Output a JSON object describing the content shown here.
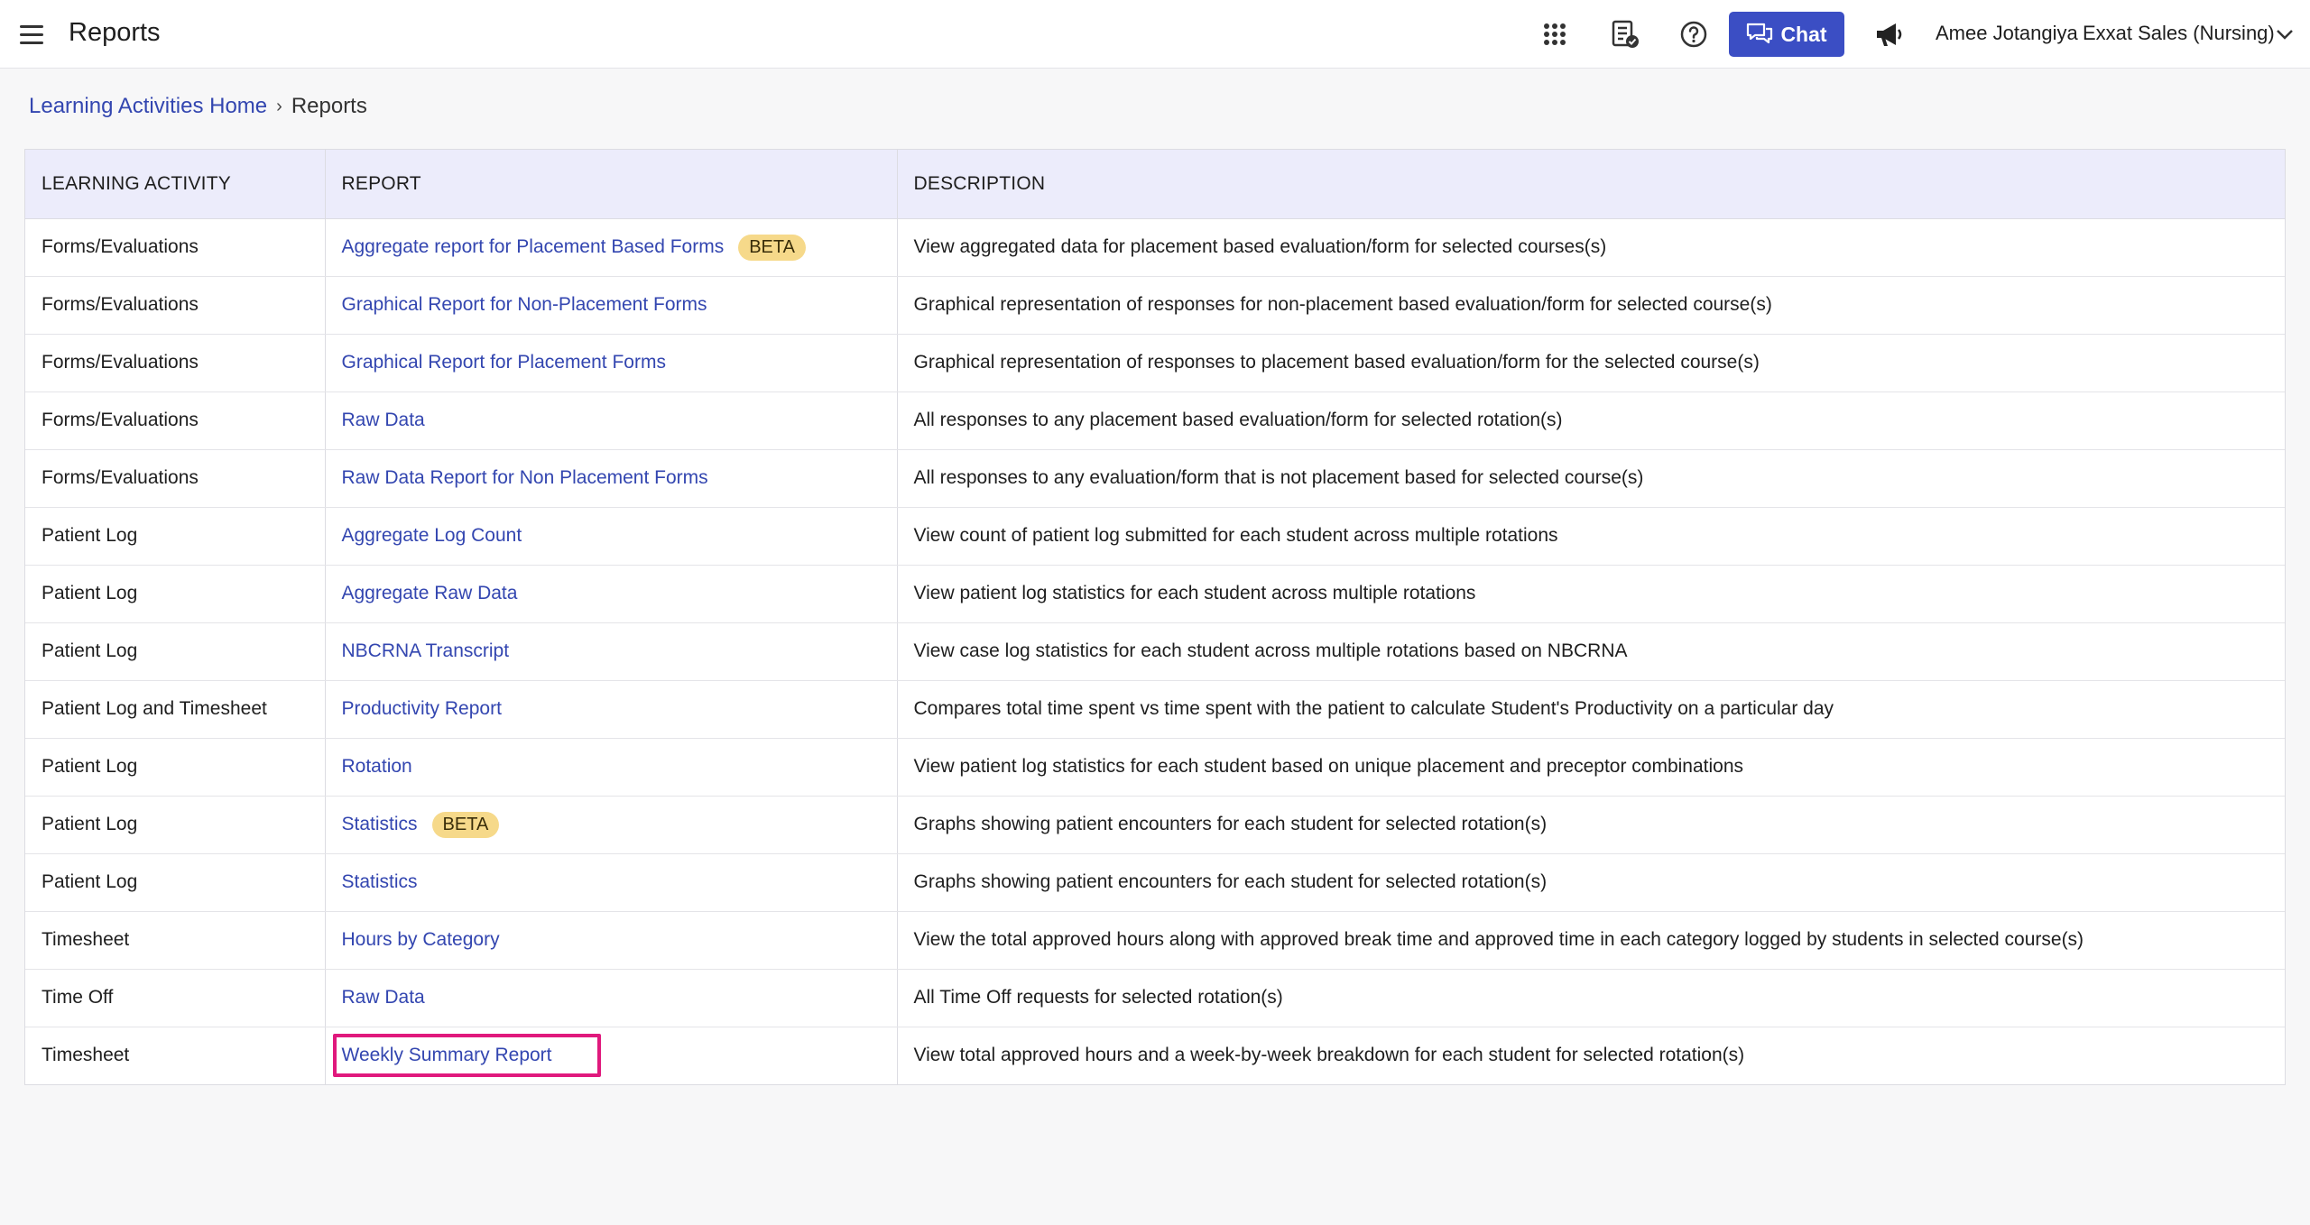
{
  "header": {
    "title": "Reports",
    "chat_label": "Chat",
    "user_name": "Amee Jotangiya",
    "org_name": "Exxat Sales (Nursing)"
  },
  "breadcrumb": {
    "home": "Learning Activities Home",
    "current": "Reports"
  },
  "table": {
    "columns": [
      "LEARNING ACTIVITY",
      "REPORT",
      "DESCRIPTION"
    ],
    "beta_label": "BETA",
    "rows": [
      {
        "activity": "Forms/Evaluations",
        "report": "Aggregate report for Placement Based Forms",
        "beta": true,
        "description": "View aggregated data for placement based evaluation/form for selected courses(s)"
      },
      {
        "activity": "Forms/Evaluations",
        "report": "Graphical Report for Non-Placement Forms",
        "beta": false,
        "description": "Graphical representation of responses for non-placement based evaluation/form for selected course(s)"
      },
      {
        "activity": "Forms/Evaluations",
        "report": "Graphical Report for Placement Forms",
        "beta": false,
        "description": "Graphical representation of responses to placement based evaluation/form for the selected course(s)"
      },
      {
        "activity": "Forms/Evaluations",
        "report": "Raw Data",
        "beta": false,
        "description": "All responses to any placement based evaluation/form for selected rotation(s)"
      },
      {
        "activity": "Forms/Evaluations",
        "report": "Raw Data Report for Non Placement Forms",
        "beta": false,
        "description": "All responses to any evaluation/form that is not placement based for selected course(s)"
      },
      {
        "activity": "Patient Log",
        "report": "Aggregate Log Count",
        "beta": false,
        "description": "View count of patient log submitted for each student across multiple rotations"
      },
      {
        "activity": "Patient Log",
        "report": "Aggregate Raw Data",
        "beta": false,
        "description": "View patient log statistics for each student across multiple rotations"
      },
      {
        "activity": "Patient Log",
        "report": "NBCRNA Transcript",
        "beta": false,
        "description": "View case log statistics for each student across multiple rotations based on NBCRNA"
      },
      {
        "activity": "Patient Log and Timesheet",
        "report": "Productivity Report",
        "beta": false,
        "description": "Compares total time spent vs time spent with the patient to calculate Student's Productivity on a particular day"
      },
      {
        "activity": "Patient Log",
        "report": "Rotation",
        "beta": false,
        "description": "View patient log statistics for each student based on unique placement and preceptor combinations"
      },
      {
        "activity": "Patient Log",
        "report": "Statistics",
        "beta": true,
        "description": "Graphs showing patient encounters for each student for selected rotation(s)"
      },
      {
        "activity": "Patient Log",
        "report": "Statistics",
        "beta": false,
        "description": "Graphs showing patient encounters for each student for selected rotation(s)"
      },
      {
        "activity": "Timesheet",
        "report": "Hours by Category",
        "beta": false,
        "description": "View the total approved hours along with approved break time and approved time in each category logged by students in selected course(s)"
      },
      {
        "activity": "Time Off",
        "report": "Raw Data",
        "beta": false,
        "description": "All Time Off requests for selected rotation(s)"
      },
      {
        "activity": "Timesheet",
        "report": "Weekly Summary Report",
        "beta": false,
        "highlighted": true,
        "description": "View total approved hours and a week-by-week breakdown for each student for selected rotation(s)"
      }
    ]
  },
  "icons": {
    "menu": "hamburger-icon",
    "apps": "grid-icon",
    "tasks": "checklist-icon",
    "help": "help-icon",
    "chat": "chat-icon",
    "announcements": "megaphone-icon",
    "org_dropdown": "chevron-down-icon"
  },
  "colors": {
    "accent": "#3b4ec4",
    "link": "#3346b0",
    "header_row": "#ececfb",
    "beta_badge": "#f6d98a",
    "highlight_border": "#e0197d"
  }
}
